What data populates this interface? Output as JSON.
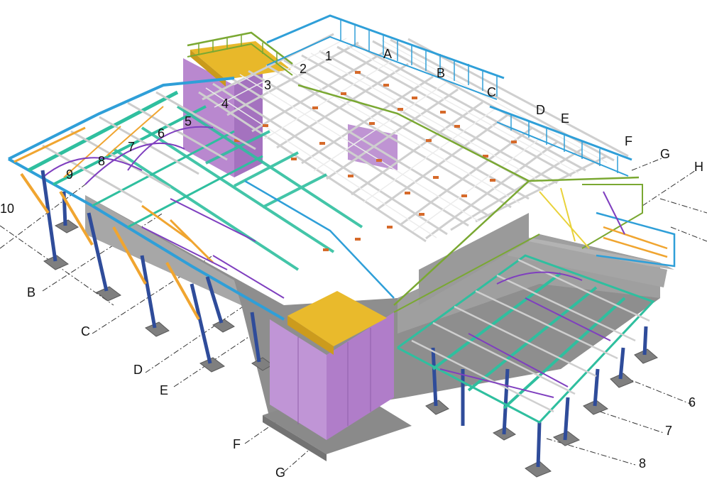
{
  "colors": {
    "background": "#ffffff",
    "concrete": "#9a9a9a",
    "concrete_dark": "#7b7b7b",
    "concrete_light": "#b8b8b8",
    "core_wall": "#b98ad0",
    "core_wall_dark": "#9c6cb6",
    "roof_slab": "#e9b92b",
    "steel_beam": "#c8c8c8",
    "steel_beam_light": "#e6e6e6",
    "column_blue": "#2f4c9a",
    "brace_orange": "#f0a530",
    "brace_purple": "#7f3fbf",
    "teal_beam": "#2fbf9f",
    "rail_green": "#7aa832",
    "rail_blue": "#2f9fd8",
    "connection": "#d66a2a",
    "grid_line": "#333333"
  },
  "grid_labels": {
    "left_side": [
      "10",
      "B",
      "C",
      "D",
      "E",
      "F",
      "G"
    ],
    "right_side": [
      "6",
      "7",
      "8"
    ],
    "top_letters": [
      "A",
      "B",
      "C",
      "D",
      "E",
      "F",
      "G",
      "H"
    ],
    "top_numbers": [
      "1",
      "2",
      "3",
      "4",
      "5",
      "6",
      "7",
      "8",
      "9"
    ]
  }
}
